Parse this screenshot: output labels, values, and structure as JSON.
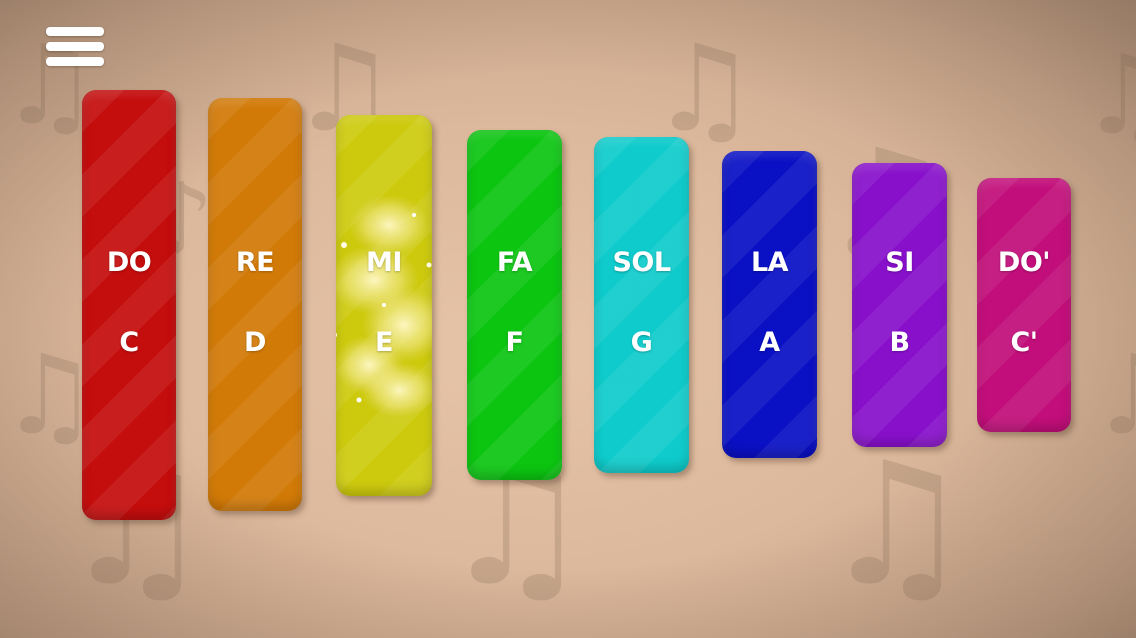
{
  "menu": {
    "icon": "hamburger-menu-icon"
  },
  "keys": [
    {
      "solfege": "DO",
      "letter": "C",
      "color": "#c40d0d"
    },
    {
      "solfege": "RE",
      "letter": "D",
      "color": "#d27a08"
    },
    {
      "solfege": "MI",
      "letter": "E",
      "color": "#cdca0e"
    },
    {
      "solfege": "FA",
      "letter": "F",
      "color": "#0cc511"
    },
    {
      "solfege": "SOL",
      "letter": "G",
      "color": "#0fcbcb"
    },
    {
      "solfege": "LA",
      "letter": "A",
      "color": "#0a10c4"
    },
    {
      "solfege": "SI",
      "letter": "B",
      "color": "#8810cb"
    },
    {
      "solfege": "DO'",
      "letter": "C'",
      "color": "#c20e7a"
    }
  ],
  "background": {
    "color": "#dcb89c",
    "decoration": "music-note-icon"
  },
  "effects": {
    "active_key": "MI",
    "sparkle": "sparkle-effect"
  }
}
